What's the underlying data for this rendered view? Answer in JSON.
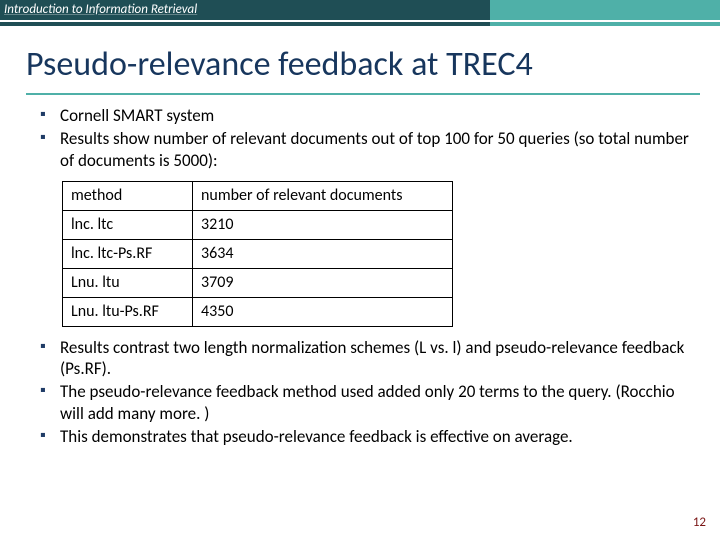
{
  "header": {
    "course": "Introduction to Information Retrieval"
  },
  "title": "Pseudo-relevance feedback at TREC4",
  "bullets_top": [
    "Cornell SMART system",
    "Results show number of relevant documents out of top 100 for 50 queries (so total number of documents is 5000):"
  ],
  "table": {
    "headers": [
      "method",
      "number of relevant documents"
    ],
    "rows": [
      [
        "lnc. ltc",
        "3210"
      ],
      [
        "lnc. ltc-Ps.RF",
        "3634"
      ],
      [
        "Lnu. ltu",
        "3709"
      ],
      [
        "Lnu. ltu-Ps.RF",
        "4350"
      ]
    ]
  },
  "bullets_bottom": [
    "Results contrast two length normalization schemes (L vs. l) and pseudo-relevance feedback (Ps.RF).",
    "The pseudo-relevance feedback method used added only 20 terms to the query. (Rocchio will add many more. )",
    "This demonstrates that pseudo-relevance feedback is effective on average."
  ],
  "page_number": "12",
  "chart_data": {
    "type": "table",
    "title": "Pseudo-relevance feedback at TREC4",
    "columns": [
      "method",
      "number of relevant documents"
    ],
    "rows": [
      {
        "method": "lnc. ltc",
        "value": 3210
      },
      {
        "method": "lnc. ltc-Ps.RF",
        "value": 3634
      },
      {
        "method": "Lnu. ltu",
        "value": 3709
      },
      {
        "method": "Lnu. ltu-Ps.RF",
        "value": 4350
      }
    ]
  }
}
